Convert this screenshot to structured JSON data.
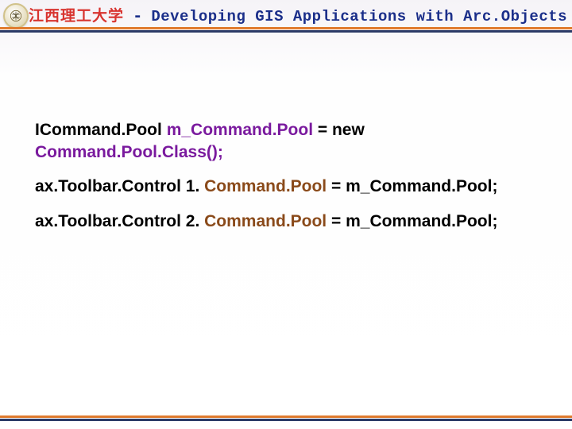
{
  "header": {
    "uni_cn": "江西理工大学",
    "dash": " - ",
    "course_en": "Developing GIS Applications with Arc.Objects using C#. NET",
    "logo_name": "university-emblem"
  },
  "code": {
    "l1a": "ICommand.Pool ",
    "l1b": " m_Command.Pool",
    "l1c": " = new",
    "l2a": "Command.Pool.Class();",
    "l3a": "ax.Toolbar.Control 1. ",
    "l3b": "Command.Pool",
    "l3c": " = m_Command.Pool;",
    "l4a": "ax.Toolbar.Control 2. ",
    "l4b": "Command.Pool",
    "l4c": " = m_Command.Pool;"
  },
  "colors": {
    "rule_top": "#e07b2e",
    "rule_bottom": "#2b3a66",
    "title_cn": "#d8342f",
    "title_en": "#1b2f8a",
    "ident_purple": "#7a1a9e",
    "ident_brown": "#8a4a1a"
  }
}
